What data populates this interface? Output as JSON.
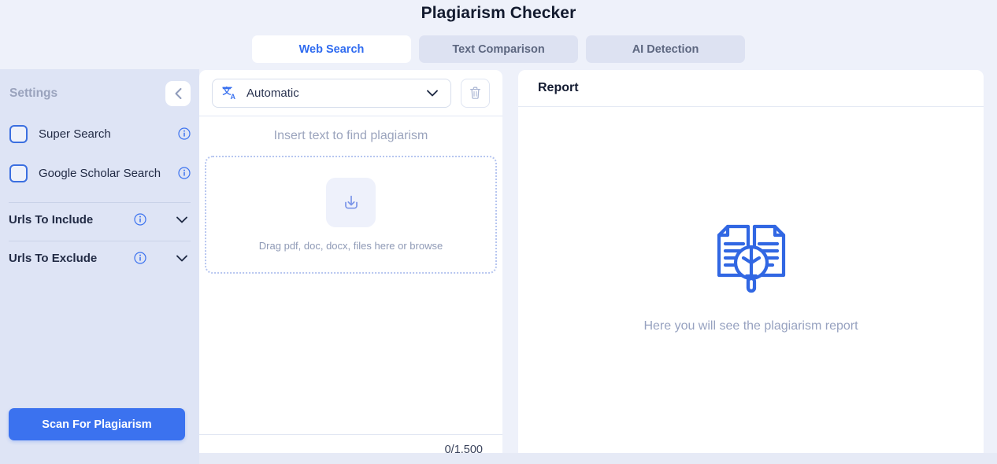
{
  "header": {
    "title": "Plagiarism Checker",
    "tabs": [
      {
        "label": "Web Search",
        "active": true
      },
      {
        "label": "Text Comparison",
        "active": false
      },
      {
        "label": "AI Detection",
        "active": false
      }
    ]
  },
  "sidebar": {
    "title": "Settings",
    "collapse_icon": "chevron-left-icon",
    "checkboxes": [
      {
        "label": "Super Search",
        "checked": false,
        "info_icon": "info-icon"
      },
      {
        "label": "Google Scholar Search",
        "checked": false,
        "info_icon": "info-icon"
      }
    ],
    "url_sections": [
      {
        "label": "Urls To Include",
        "info_icon": "info-icon",
        "expand_icon": "chevron-down-icon"
      },
      {
        "label": "Urls To Exclude",
        "info_icon": "info-icon",
        "expand_icon": "chevron-down-icon"
      }
    ],
    "scan_button": "Scan For Plagiarism"
  },
  "editor": {
    "language": "Automatic",
    "language_icon": "translate-icon",
    "dropdown_icon": "chevron-down-icon",
    "delete_icon": "trash-icon",
    "insert_hint": "Insert text to find plagiarism",
    "upload_icon": "download-arrow-icon",
    "dropzone_text": "Drag pdf, doc, docx, files here or browse",
    "char_count": "0/1,500"
  },
  "report": {
    "title": "Report",
    "illustration_icon": "documents-magnifier-icon",
    "empty_text": "Here you will see the plagiarism report"
  },
  "colors": {
    "accent": "#3b72ef",
    "page_background": "#eef1fa",
    "sidebar_background": "#dee4f5",
    "tab_inactive": "#dde2f2",
    "panel": "#ffffff",
    "muted_text": "#97a2c0"
  }
}
